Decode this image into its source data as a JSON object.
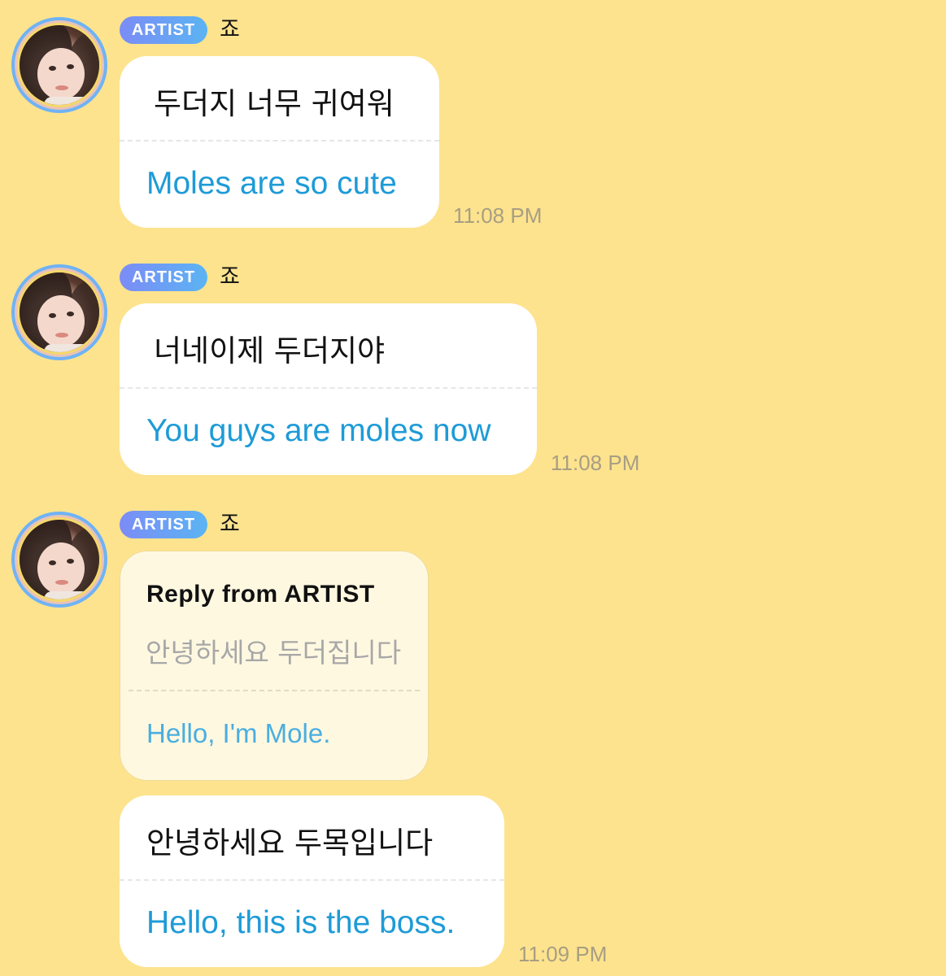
{
  "messages": [
    {
      "badge": "ARTIST",
      "username": "죠",
      "original": "두더지 너무 귀여워",
      "translation": "Moles are so cute",
      "time": "11:08 PM"
    },
    {
      "badge": "ARTIST",
      "username": "죠",
      "original": "너네이제 두더지야",
      "translation": "You guys are moles now",
      "time": "11:08 PM"
    },
    {
      "badge": "ARTIST",
      "username": "죠",
      "reply": {
        "title": "Reply from ARTIST",
        "original": "안녕하세요 두더집니다",
        "translation": "Hello, I'm Mole."
      },
      "original": "안녕하세요 두목입니다",
      "translation": "Hello, this is the boss.",
      "time": "11:09 PM"
    }
  ],
  "colors": {
    "background": "#FDE38E",
    "bubble": "#FFFFFF",
    "translation_text": "#1E9BD7",
    "timestamp": "#A79E83",
    "badge_gradient_start": "#7B8CF6",
    "badge_gradient_end": "#5BB4F3",
    "reply_card_bg": "#FFF8E1"
  },
  "icons": {
    "avatar": "artist-profile-photo"
  }
}
